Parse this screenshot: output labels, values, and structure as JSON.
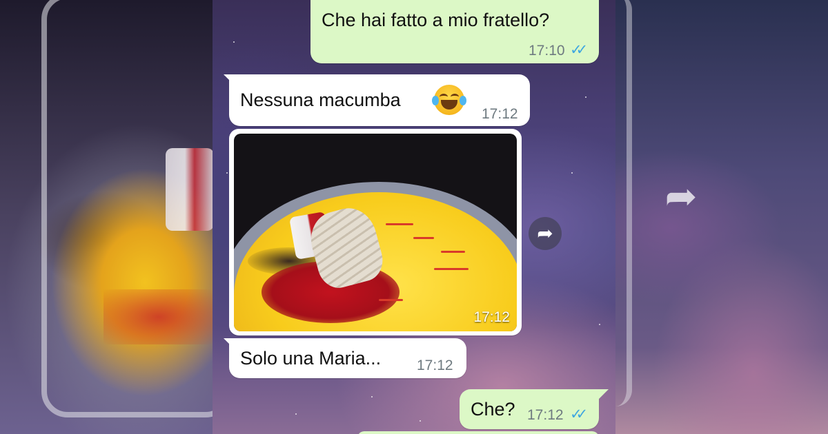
{
  "messages": [
    {
      "direction": "out",
      "text": "Che hai fatto a mio fratello?",
      "time": "17:10",
      "status": "read"
    },
    {
      "direction": "in",
      "text": "Nessuna macumba",
      "emoji": "face-with-tears-of-joy",
      "time": "17:12"
    },
    {
      "direction": "in",
      "type": "image",
      "image_subject": "painting of a voodoo doll bleeding on a yellow floor",
      "time": "17:12"
    },
    {
      "direction": "in",
      "text": "Solo una Maria...",
      "time": "17:12"
    },
    {
      "direction": "out",
      "text": "Che?",
      "time": "17:12",
      "status": "read"
    }
  ],
  "colors": {
    "outgoing_bubble": "#dcf8c6",
    "incoming_bubble": "#ffffff",
    "read_ticks": "#3fa7e0",
    "timestamp": "#6e7a80"
  },
  "icons": {
    "forward": "forward-arrow-icon",
    "read_receipt": "double-check-icon"
  }
}
